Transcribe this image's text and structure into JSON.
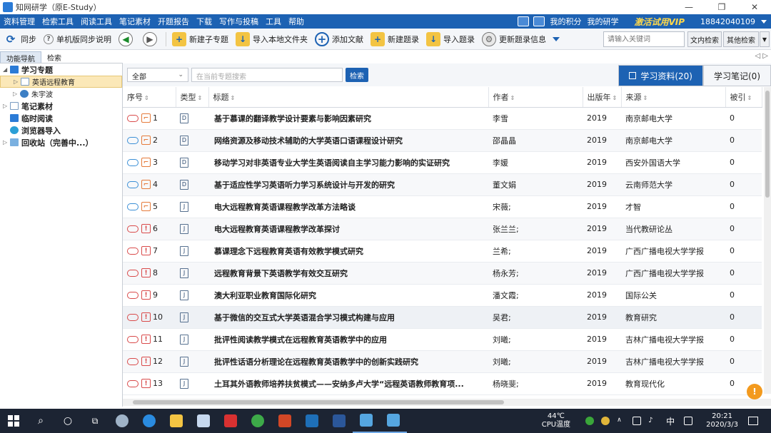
{
  "window": {
    "title": "知网研学（原E-Study）",
    "controls": [
      "—",
      "❐",
      "✕"
    ]
  },
  "menu": {
    "items": [
      "资料管理",
      "检索工具",
      "阅读工具",
      "笔记素材",
      "开题报告",
      "下载",
      "写作与投稿",
      "工具",
      "帮助"
    ],
    "points": "我的积分",
    "my_study": "我的研学",
    "vip": "激活试用VIP",
    "account": "18842040109"
  },
  "toolbar": {
    "sync": "同步",
    "sync_help": "单机版同步说明",
    "new_topic": "新建子专题",
    "import_folder": "导入本地文件夹",
    "add_literature": "添加文献",
    "new_record": "新建题录",
    "import_record": "导入题录",
    "update_record": "更新题录信息",
    "search_placeholder": "请输入关键词",
    "search_in_docs": "文内检索",
    "other_search": "其他检索"
  },
  "sidebar": {
    "tabs": [
      "功能导航",
      "检索"
    ],
    "tree": [
      {
        "label": "学习专题",
        "level": 0
      },
      {
        "label": "英语远程教育",
        "level": 1,
        "selected": true
      },
      {
        "label": "朱宇波",
        "level": 1
      },
      {
        "label": "笔记素材",
        "level": 0
      },
      {
        "label": "临时阅读",
        "level": 0
      },
      {
        "label": "浏览器导入",
        "level": 0
      },
      {
        "label": "回收站（完善中...）",
        "level": 0
      }
    ]
  },
  "main": {
    "scope_select": "全部",
    "search_placeholder": "在当前专题搜索",
    "search_button": "检索",
    "tab_materials": "学习资料(20)",
    "tab_notes": "学习笔记(0)",
    "columns": [
      "序号",
      "类型",
      "标题",
      "作者",
      "出版年",
      "来源",
      "被引"
    ],
    "rows": [
      {
        "n": "1",
        "type": "D",
        "title": "基于慕课的翻译教学设计要素与影响因素研究",
        "author": "李雪",
        "year": "2019",
        "source": "南京邮电大学",
        "cited": "0",
        "cloud": "red",
        "flag": "orange"
      },
      {
        "n": "2",
        "type": "D",
        "title": "网络资源及移动技术辅助的大学英语口语课程设计研究",
        "author": "邵晶晶",
        "year": "2019",
        "source": "南京邮电大学",
        "cited": "0",
        "cloud": "blue",
        "flag": "orange"
      },
      {
        "n": "3",
        "type": "D",
        "title": "移动学习对非英语专业大学生英语阅读自主学习能力影响的实证研究",
        "author": "李媛",
        "year": "2019",
        "source": "西安外国语大学",
        "cited": "0",
        "cloud": "blue",
        "flag": "orange"
      },
      {
        "n": "4",
        "type": "D",
        "title": "基于适应性学习英语听力学习系统设计与开发的研究",
        "author": "董文娟",
        "year": "2019",
        "source": "云南师范大学",
        "cited": "0",
        "cloud": "blue",
        "flag": "orange"
      },
      {
        "n": "5",
        "type": "J",
        "title": "电大远程教育英语课程教学改革方法略谈",
        "author": "宋薇;",
        "year": "2019",
        "source": "才智",
        "cited": "0",
        "cloud": "blue",
        "flag": "orange"
      },
      {
        "n": "6",
        "type": "J",
        "title": "电大远程教育英语课程教学改革探讨",
        "author": "张兰兰;",
        "year": "2019",
        "source": "当代教研论丛",
        "cited": "0",
        "cloud": "red",
        "flag": "red"
      },
      {
        "n": "7",
        "type": "J",
        "title": "慕课理念下远程教育英语有效教学模式研究",
        "author": "兰希;",
        "year": "2019",
        "source": "广西广播电视大学学报",
        "cited": "0",
        "cloud": "red",
        "flag": "red"
      },
      {
        "n": "8",
        "type": "J",
        "title": "远程教育背景下英语教学有效交互研究",
        "author": "杨永芳;",
        "year": "2019",
        "source": "广西广播电视大学学报",
        "cited": "0",
        "cloud": "red",
        "flag": "red"
      },
      {
        "n": "9",
        "type": "J",
        "title": "澳大利亚职业教育国际化研究",
        "author": "潘文霞;",
        "year": "2019",
        "source": "国际公关",
        "cited": "0",
        "cloud": "red",
        "flag": "red"
      },
      {
        "n": "10",
        "type": "J",
        "title": "基于微信的交互式大学英语混合学习模式构建与应用",
        "author": "吴君;",
        "year": "2019",
        "source": "教育研究",
        "cited": "0",
        "cloud": "red",
        "flag": "red"
      },
      {
        "n": "11",
        "type": "J",
        "title": "批评性阅读教学模式在远程教育英语教学中的应用",
        "author": "刘曦;",
        "year": "2019",
        "source": "吉林广播电视大学学报",
        "cited": "0",
        "cloud": "red",
        "flag": "red"
      },
      {
        "n": "12",
        "type": "J",
        "title": "批评性话语分析理论在远程教育英语教学中的创新实践研究",
        "author": "刘曦;",
        "year": "2019",
        "source": "吉林广播电视大学学报",
        "cited": "0",
        "cloud": "red",
        "flag": "red"
      },
      {
        "n": "13",
        "type": "J",
        "title": "土耳其外语教师培养扶贫模式——安纳多卢大学“远程英语教师教育项...",
        "author": "杨晓斐;",
        "year": "2019",
        "source": "教育现代化",
        "cited": "0",
        "cloud": "red",
        "flag": "red"
      }
    ]
  },
  "taskbar": {
    "cpu_temp": "44℃",
    "cpu_label": "CPU温度",
    "lang": "中",
    "time": "20:21",
    "date": "2020/3/3"
  },
  "colors": {
    "menu_bg": "#1d62b3",
    "vip": "#ffd84a",
    "taskbar": "#1c2433"
  }
}
